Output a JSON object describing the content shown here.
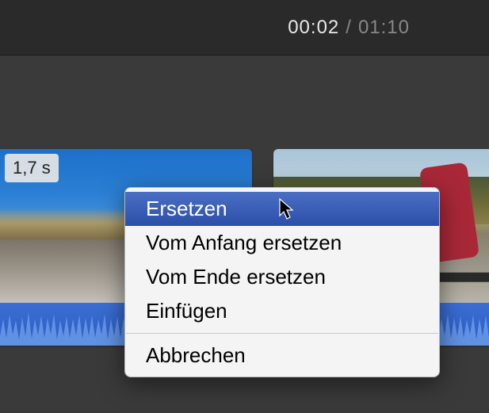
{
  "toolbar": {
    "current_time": "00:02",
    "separator": "/",
    "total_time": "01:10"
  },
  "timeline": {
    "clip_left": {
      "duration_badge": "1,7 s"
    }
  },
  "context_menu": {
    "items": [
      {
        "label": "Ersetzen",
        "highlighted": true
      },
      {
        "label": "Vom Anfang ersetzen",
        "highlighted": false
      },
      {
        "label": "Vom Ende ersetzen",
        "highlighted": false
      },
      {
        "label": "Einfügen",
        "highlighted": false
      }
    ],
    "cancel_label": "Abbrechen"
  }
}
